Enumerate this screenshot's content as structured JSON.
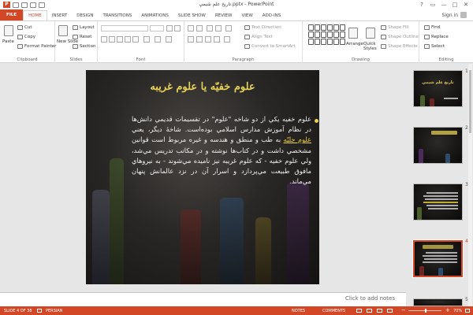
{
  "window": {
    "title": "تاريخ علم شيمي.pptx - PowerPoint",
    "controls": [
      "?",
      "▭",
      "—",
      "□",
      "✕"
    ]
  },
  "tabs": [
    "FILE",
    "HOME",
    "INSERT",
    "DESIGN",
    "TRANSITIONS",
    "ANIMATIONS",
    "SLIDE SHOW",
    "REVIEW",
    "VIEW",
    "ADD-INS"
  ],
  "active_tab": "HOME",
  "account": {
    "label": "Sign in"
  },
  "ribbon": {
    "clipboard": {
      "paste": "Paste",
      "cut": "Cut",
      "copy": "Copy",
      "format_painter": "Format Painter",
      "label": "Clipboard"
    },
    "slides": {
      "new_slide": "New Slide",
      "layout": "Layout",
      "reset": "Reset",
      "section": "Section",
      "label": "Slides"
    },
    "font": {
      "label": "Font"
    },
    "paragraph": {
      "text_direction": "Text Direction",
      "align_text": "Align Text",
      "convert_smartart": "Convert to SmartArt",
      "label": "Paragraph"
    },
    "drawing": {
      "arrange": "Arrange",
      "quick_styles": "Quick Styles",
      "shape_fill": "Shape Fill",
      "shape_outline": "Shape Outline",
      "shape_effects": "Shape Effects",
      "label": "Drawing"
    },
    "editing": {
      "find": "Find",
      "replace": "Replace",
      "select": "Select",
      "label": "Editing"
    }
  },
  "slide": {
    "title": "علوم خفيّه يا علوم غريبه",
    "body_before": "علوم خفيه يكي از دو شاخه \"علوم\" در تقسيمات قديمي دانش‌ها در نظام آموزش مدارس اسلامي بوده‌است. شاخهٔ ديگر، يعني ",
    "body_link": "علوم جليّه",
    "body_after": " به طب و منطق و هندسه و غيره مربوط است قوانين مشخصي داشت و در کتاب‌ها نوشته و در مکاتب تدريس مي‌شد، ولي علوم خفيه - که علوم غريبه نيز ناميده مي‌شوند - به نيروهاي مافوق طبيعت مي‌پردازد و اسرار آن در نزد عالمانش پنهان مي‌ماند."
  },
  "thumbnails": [
    {
      "number": "1",
      "title": "تاريخ علم شيمي"
    },
    {
      "number": "2",
      "title": ""
    },
    {
      "number": "3",
      "title": ""
    },
    {
      "number": "4",
      "title": ""
    },
    {
      "number": "5",
      "title": ""
    }
  ],
  "selected_slide": 4,
  "notes_placeholder": "Click to add notes",
  "status": {
    "slide_info": "SLIDE 4 OF 38",
    "language": "PERSIAN",
    "notes": "NOTES",
    "comments": "COMMENTS",
    "zoom": "70%"
  },
  "colors": {
    "accent": "#d24726",
    "title_gold": "#e6cf55",
    "link": "#e8d23a"
  }
}
